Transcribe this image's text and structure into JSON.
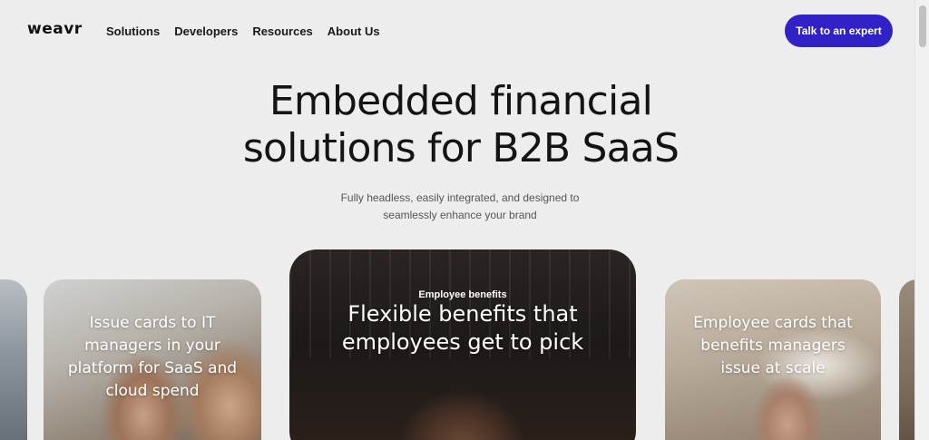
{
  "nav": {
    "logo": "weavr",
    "items": [
      "Solutions",
      "Developers",
      "Resources",
      "About Us"
    ],
    "cta": "Talk to an expert"
  },
  "hero": {
    "title_line1": "Embedded financial",
    "title_line2": "solutions for B2B SaaS",
    "subtitle_line1": "Fully headless, easily integrated, and designed to",
    "subtitle_line2": "seamlessly enhance your brand"
  },
  "cards": {
    "left": {
      "text": "Issue cards to IT managers in your platform for SaaS and cloud spend"
    },
    "main": {
      "eyebrow": "Employee benefits",
      "text": "Flexible benefits that employees get to pick"
    },
    "right": {
      "text": "Employee cards that benefits managers issue at scale"
    }
  },
  "colors": {
    "background": "#ededee",
    "accent": "#3022c6"
  }
}
